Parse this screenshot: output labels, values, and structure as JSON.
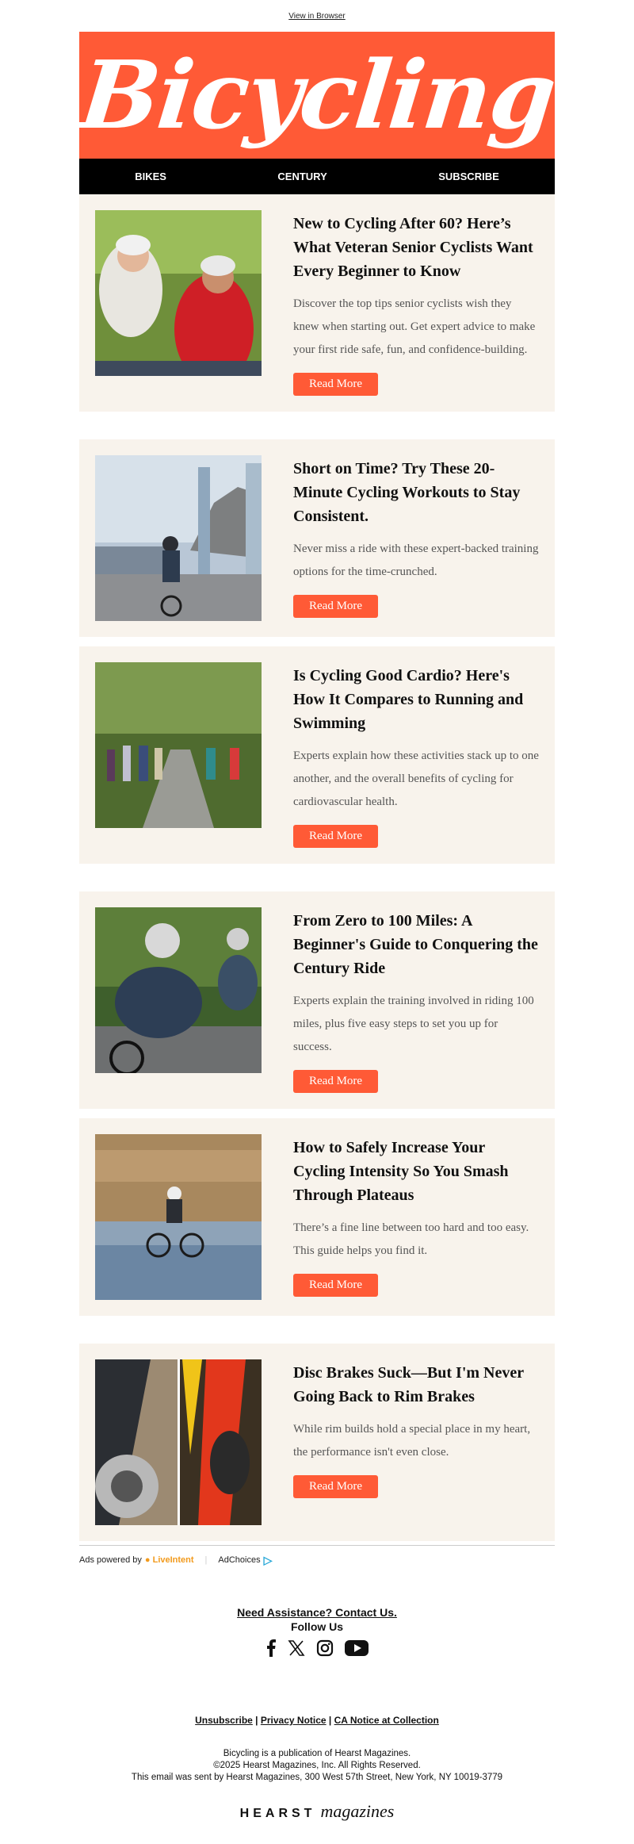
{
  "topbar": {
    "view_in_browser": "View in Browser"
  },
  "brand": {
    "logo_text": "Bicycling",
    "accent_color": "#ff5a36",
    "card_bg": "#f8f3ec"
  },
  "nav": {
    "items": [
      "BIKES",
      "CENTURY",
      "SUBSCRIBE"
    ]
  },
  "articles": [
    {
      "title": "New to Cycling After 60? Here’s What Veteran Senior Cyclists Want Every Beginner to Know",
      "summary": "Discover the top tips senior cyclists wish they knew when starting out. Get expert advice to make your first ride safe, fun, and confidence-building.",
      "button": "Read More"
    },
    {
      "title": "Short on Time? Try These 20-Minute Cycling Workouts to Stay Consistent.",
      "summary": "Never miss a ride with these expert-backed training options for the time-crunched.",
      "button": "Read More"
    },
    {
      "title": "Is Cycling Good Cardio? Here's How It Compares to Running and Swimming",
      "summary": "Experts explain how these activities stack up to one another, and the overall benefits of cycling for cardiovascular health.",
      "button": "Read More"
    },
    {
      "title": "From Zero to 100 Miles: A Beginner's Guide to Conquering the Century Ride",
      "summary": "Experts explain the training involved in riding 100 miles, plus five easy steps to set you up for success.",
      "button": "Read More"
    },
    {
      "title": "How to Safely Increase Your Cycling Intensity So You Smash Through Plateaus",
      "summary": "There’s a fine line between too hard and too easy. This guide helps you find it.",
      "button": "Read More"
    },
    {
      "title": "Disc Brakes Suck—But I'm Never Going Back to Rim Brakes",
      "summary": "While rim builds hold a special place in my heart, the performance isn't even close.",
      "button": "Read More"
    }
  ],
  "ads": {
    "powered_by": "Ads powered by",
    "liveintent": "LiveIntent",
    "adchoices": "AdChoices"
  },
  "footer": {
    "help": "Need Assistance? Contact Us.",
    "follow": "Follow Us",
    "social_icons": [
      "facebook-icon",
      "x-icon",
      "instagram-icon",
      "youtube-icon"
    ],
    "unsubscribe": "Unsubscribe",
    "privacy": "Privacy Notice",
    "ca_notice": "CA Notice at Collection",
    "legal_1": "Bicycling is a publication of Hearst Magazines.",
    "legal_2": "©2025 Hearst Magazines, Inc. All Rights Reserved.",
    "legal_3": "This email was sent by Hearst Magazines, 300 West 57th Street, New York, NY 10019-3779",
    "hearst_word": "HEARST",
    "magazines_word": "magazines"
  }
}
